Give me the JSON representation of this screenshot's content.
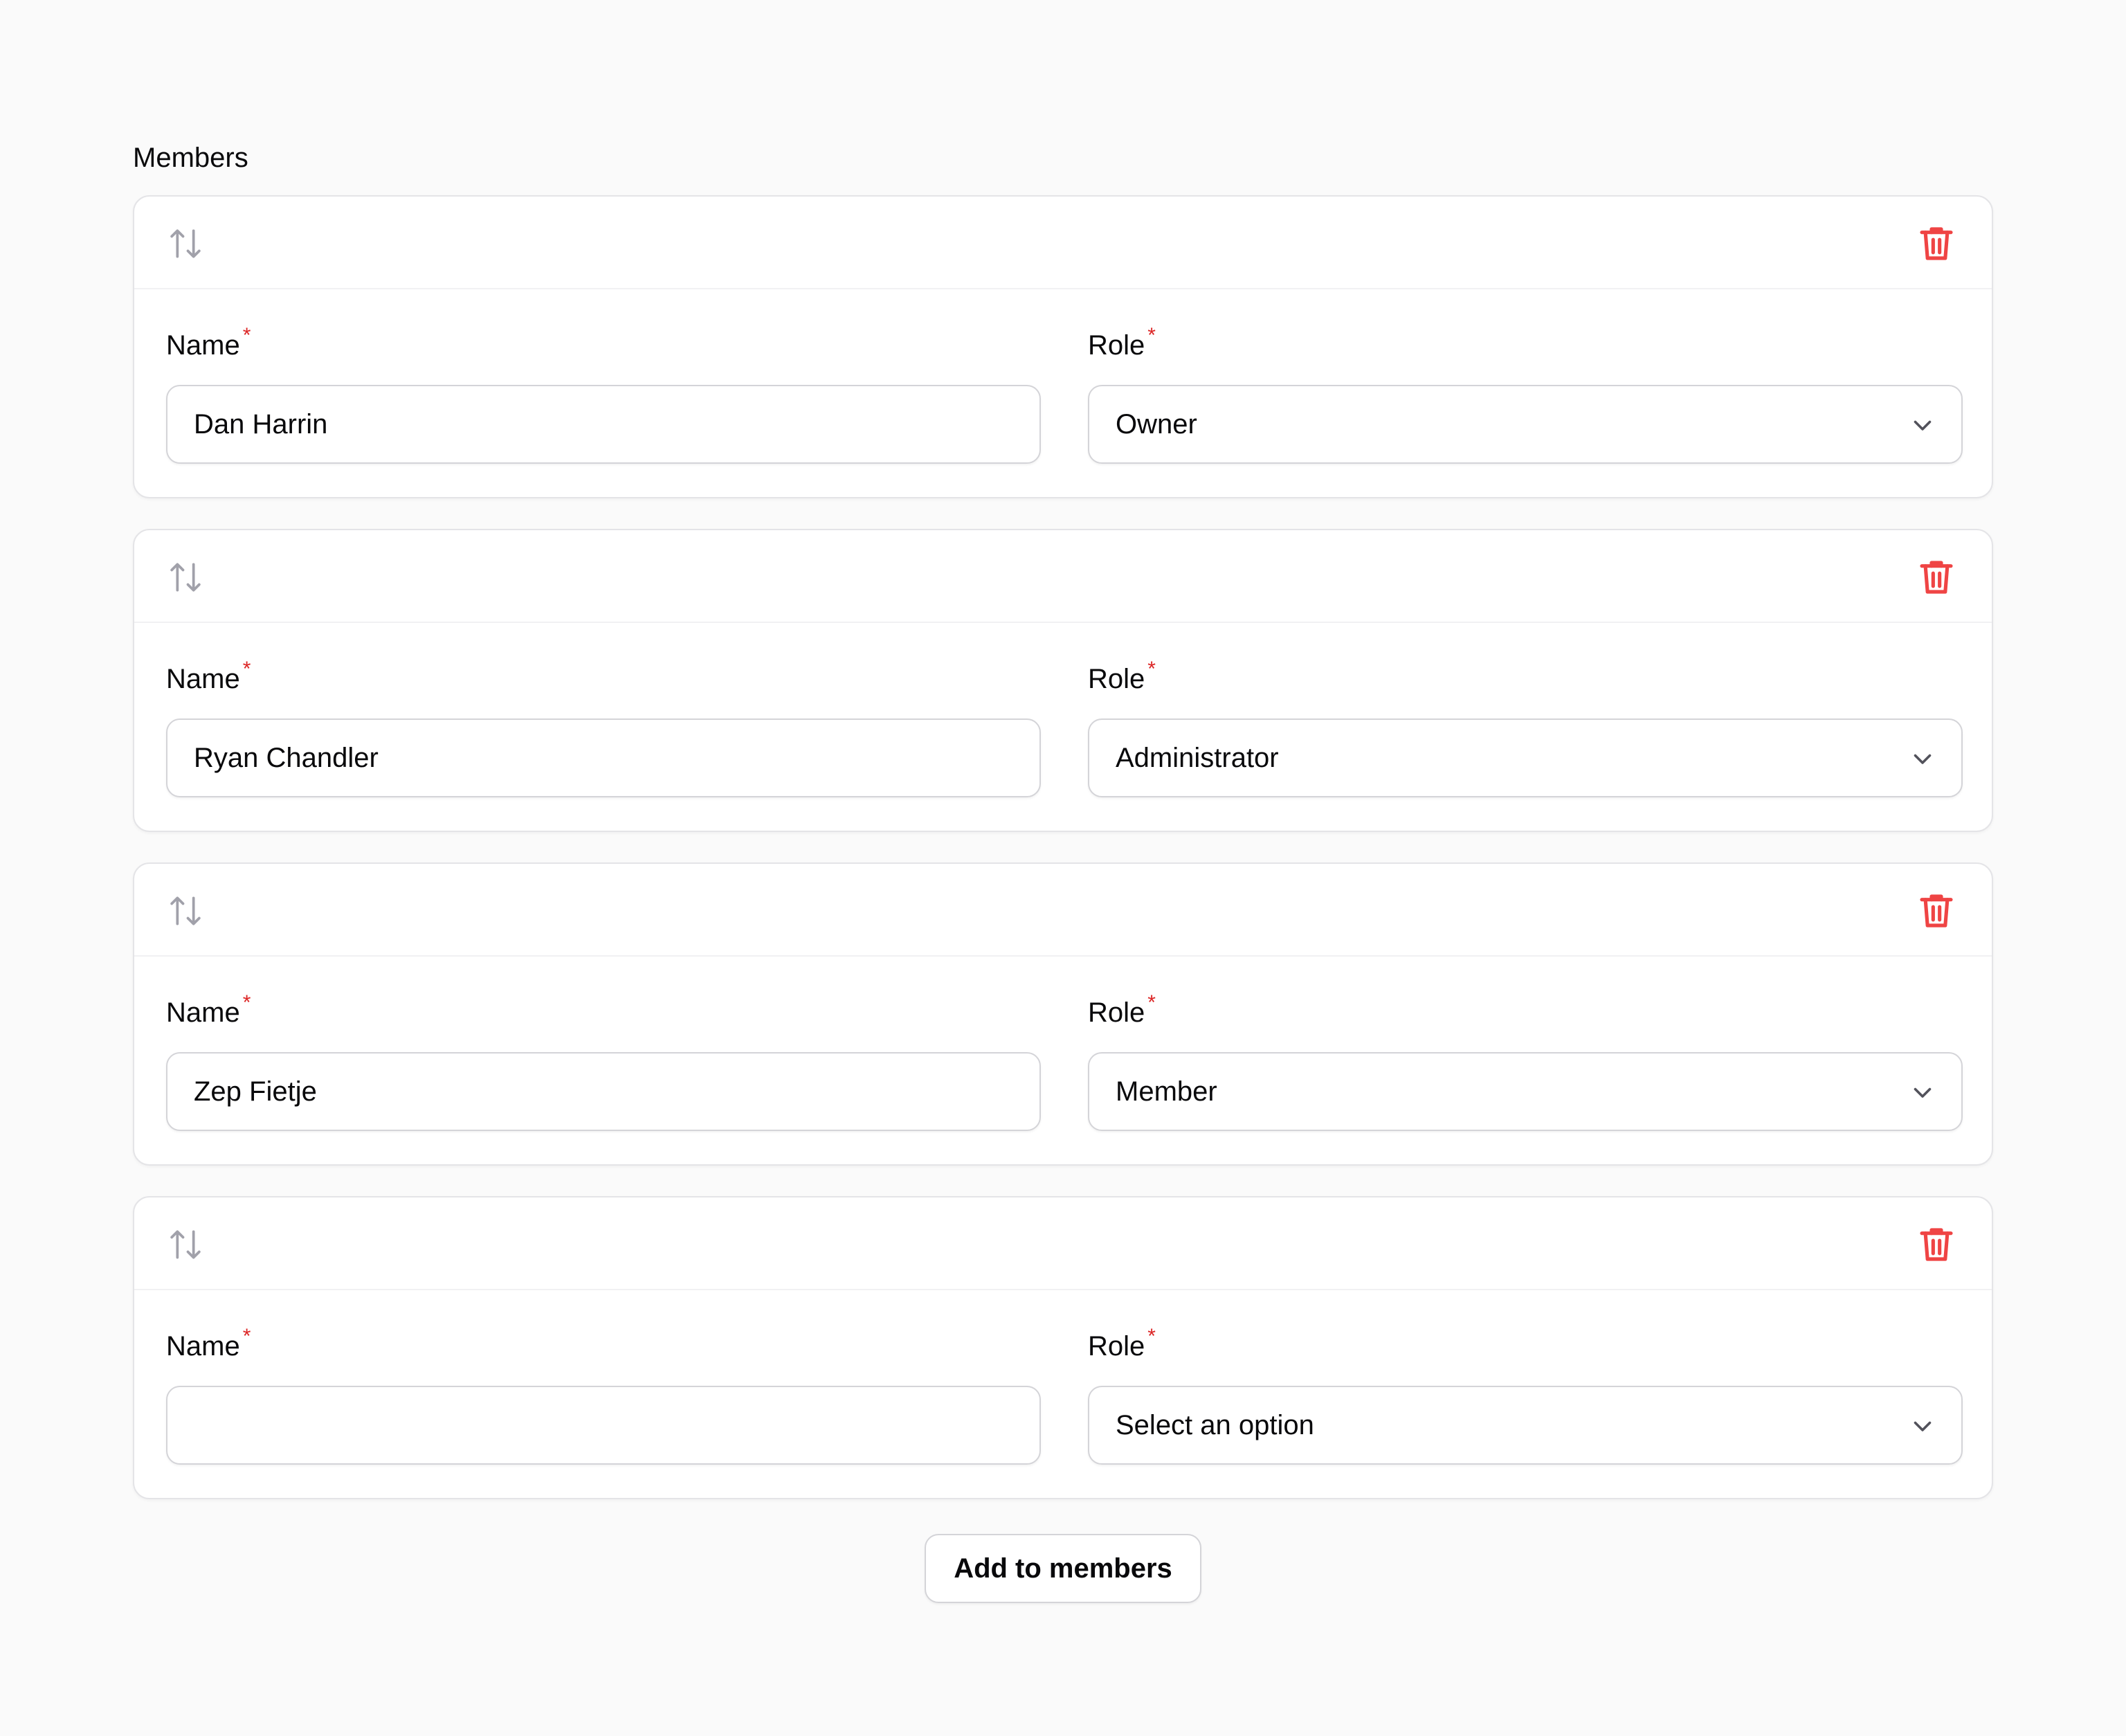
{
  "repeater": {
    "label": "Members",
    "add_button_label": "Add to members",
    "required_marker": "*",
    "icons": {
      "reorder": "arrows-up-down-icon",
      "delete": "trash-icon",
      "select": "chevron-down-icon"
    },
    "colors": {
      "delete": "#ef4444",
      "required": "#dc2626",
      "reorder": "#a1a1aa"
    },
    "items": [
      {
        "name_label": "Name",
        "role_label": "Role",
        "name_value": "Dan Harrin",
        "role_value": "Owner"
      },
      {
        "name_label": "Name",
        "role_label": "Role",
        "name_value": "Ryan Chandler",
        "role_value": "Administrator"
      },
      {
        "name_label": "Name",
        "role_label": "Role",
        "name_value": "Zep Fietje",
        "role_value": "Member"
      },
      {
        "name_label": "Name",
        "role_label": "Role",
        "name_value": "",
        "role_value": "Select an option"
      }
    ]
  }
}
